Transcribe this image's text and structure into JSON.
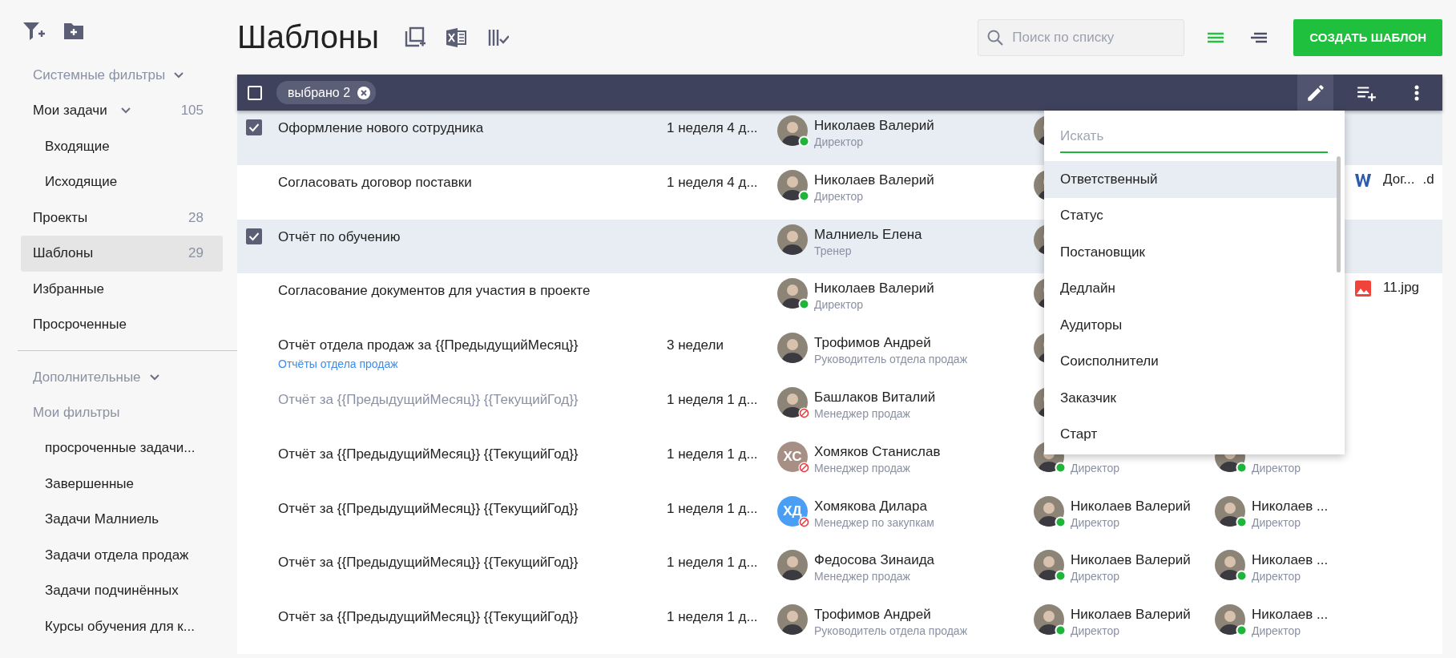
{
  "sidebar": {
    "sections": [
      {
        "title": "Системные фильтры",
        "expanded": true,
        "items": [
          {
            "label": "Мои задачи",
            "count": "105",
            "selected": false,
            "expanded": true,
            "children": [
              {
                "label": "Входящие",
                "selected": false
              },
              {
                "label": "Исходящие",
                "selected": false
              }
            ]
          },
          {
            "label": "Проекты",
            "count": "28",
            "selected": false
          },
          {
            "label": "Шаблоны",
            "count": "29",
            "selected": true
          },
          {
            "label": "Избранные",
            "selected": false
          },
          {
            "label": "Просроченные",
            "selected": false
          }
        ]
      },
      {
        "title": "Дополнительные",
        "expanded": true,
        "items": [
          {
            "label": "Мои фильтры",
            "kind": "heading",
            "children": [
              {
                "label": "просроченные задачи...",
                "selected": false
              },
              {
                "label": "Завершенные",
                "selected": false
              },
              {
                "label": "Задачи Малниель",
                "selected": false
              },
              {
                "label": "Задачи отдела продаж",
                "selected": false
              },
              {
                "label": "Задачи подчинённых",
                "selected": false
              },
              {
                "label": "Курсы обучения для к...",
                "selected": false
              }
            ]
          }
        ]
      }
    ]
  },
  "header": {
    "title": "Шаблоны",
    "search": {
      "placeholder": "Поиск по списку"
    },
    "views": [
      {
        "kind": "list",
        "selected": true
      },
      {
        "kind": "compact",
        "selected": false
      }
    ],
    "create_button": "СОЗДАТЬ ШАБЛОН"
  },
  "bulk_bar": {
    "all_checked": false,
    "chip": "выбрано 2"
  },
  "table": {
    "rows": [
      {
        "selected": true,
        "title": "Оформление нового сотрудника",
        "duration": "1 неделя 4 д...",
        "person": {
          "kind": "photo",
          "name": "Николаев Валерий",
          "role": "Директор",
          "online": true
        },
        "coexec": {
          "kind": "covered"
        }
      },
      {
        "selected": false,
        "title": "Согласовать договор поставки",
        "duration": "1 неделя 4 д...",
        "person": {
          "kind": "photo",
          "name": "Николаев Валерий",
          "role": "Директор",
          "online": true
        },
        "coexec": {
          "kind": "covered"
        },
        "attachment": {
          "kind": "word",
          "name": "Дог...",
          "ext": ".d"
        }
      },
      {
        "selected": true,
        "title": "Отчёт по обучению",
        "person": {
          "kind": "photo",
          "name": "Малниель Елена",
          "role": "Тренер"
        },
        "coexec": {
          "kind": "covered"
        }
      },
      {
        "selected": false,
        "title": "Согласование документов для участия в проекте",
        "person": {
          "kind": "photo",
          "name": "Николаев Валерий",
          "role": "Директор",
          "online": true
        },
        "coexec": {
          "kind": "covered"
        },
        "attachment": {
          "kind": "image",
          "name": "11.jpg"
        }
      },
      {
        "selected": false,
        "title": "Отчёт отдела продаж за {{ПредыдущийМесяц}}",
        "project": "Отчёты отдела продаж",
        "duration": "3 недели",
        "person": {
          "kind": "photo",
          "name": "Трофимов Андрей",
          "role": "Руководитель отдела продаж"
        },
        "coexec": {
          "kind": "covered"
        }
      },
      {
        "selected": false,
        "muted": true,
        "title": "Отчёт за {{ПредыдущийМесяц}} {{ТекущийГод}}",
        "duration": "1 неделя 1 д...",
        "person": {
          "kind": "photo",
          "name": "Башлаков Виталий",
          "role": "Менеджер продаж",
          "blocked": true
        },
        "coexec": {
          "kind": "covered"
        }
      },
      {
        "selected": false,
        "title": "Отчёт за {{ПредыдущийМесяц}} {{ТекущийГод}}",
        "duration": "1 неделя 1 д...",
        "person": {
          "kind": "initials",
          "initials": "ХС",
          "color": "#a88f86",
          "name": "Хомяков Станислав",
          "role": "Менеджер продаж",
          "blocked": true
        },
        "coexec": {
          "kind": "photo",
          "role": "Директор",
          "online": true
        },
        "observer": {
          "kind": "photo",
          "role": "Директор",
          "online": true
        }
      },
      {
        "selected": false,
        "title": "Отчёт за {{ПредыдущийМесяц}} {{ТекущийГод}}",
        "duration": "1 неделя 1 д...",
        "person": {
          "kind": "initials",
          "initials": "ХД",
          "color": "#4a9ff5",
          "name": "Хомякова Дилара",
          "role": "Менеджер по закупкам",
          "blocked": true
        },
        "coexec": {
          "kind": "photo",
          "name": "Николаев Валерий",
          "role": "Директор",
          "online": true
        },
        "observer": {
          "kind": "photo",
          "name": "Николаев ...",
          "role": "Директор",
          "online": true
        }
      },
      {
        "selected": false,
        "title": "Отчёт за {{ПредыдущийМесяц}} {{ТекущийГод}}",
        "duration": "1 неделя 1 д...",
        "person": {
          "kind": "photo",
          "name": "Федосова Зинаида",
          "role": "Менеджер продаж"
        },
        "coexec": {
          "kind": "photo",
          "name": "Николаев Валерий",
          "role": "Директор",
          "online": true
        },
        "observer": {
          "kind": "photo",
          "name": "Николаев ...",
          "role": "Директор",
          "online": true
        }
      },
      {
        "selected": false,
        "title": "Отчёт за {{ПредыдущийМесяц}} {{ТекущийГод}}",
        "duration": "1 неделя 1 д...",
        "person": {
          "kind": "photo",
          "name": "Трофимов Андрей",
          "role": "Руководитель отдела продаж"
        },
        "coexec": {
          "kind": "photo",
          "name": "Николаев Валерий",
          "role": "Директор",
          "online": true
        },
        "observer": {
          "kind": "photo",
          "name": "Николаев ...",
          "role": "Директор",
          "online": true
        }
      }
    ]
  },
  "column_menu": {
    "search": {
      "placeholder": "Искать"
    },
    "items": [
      {
        "label": "Ответственный",
        "selected": true
      },
      {
        "label": "Статус",
        "selected": false
      },
      {
        "label": "Постановщик",
        "selected": false
      },
      {
        "label": "Дедлайн",
        "selected": false
      },
      {
        "label": "Аудиторы",
        "selected": false
      },
      {
        "label": "Соисполнители",
        "selected": false
      },
      {
        "label": "Заказчик",
        "selected": false
      },
      {
        "label": "Старт",
        "selected": false
      }
    ]
  }
}
